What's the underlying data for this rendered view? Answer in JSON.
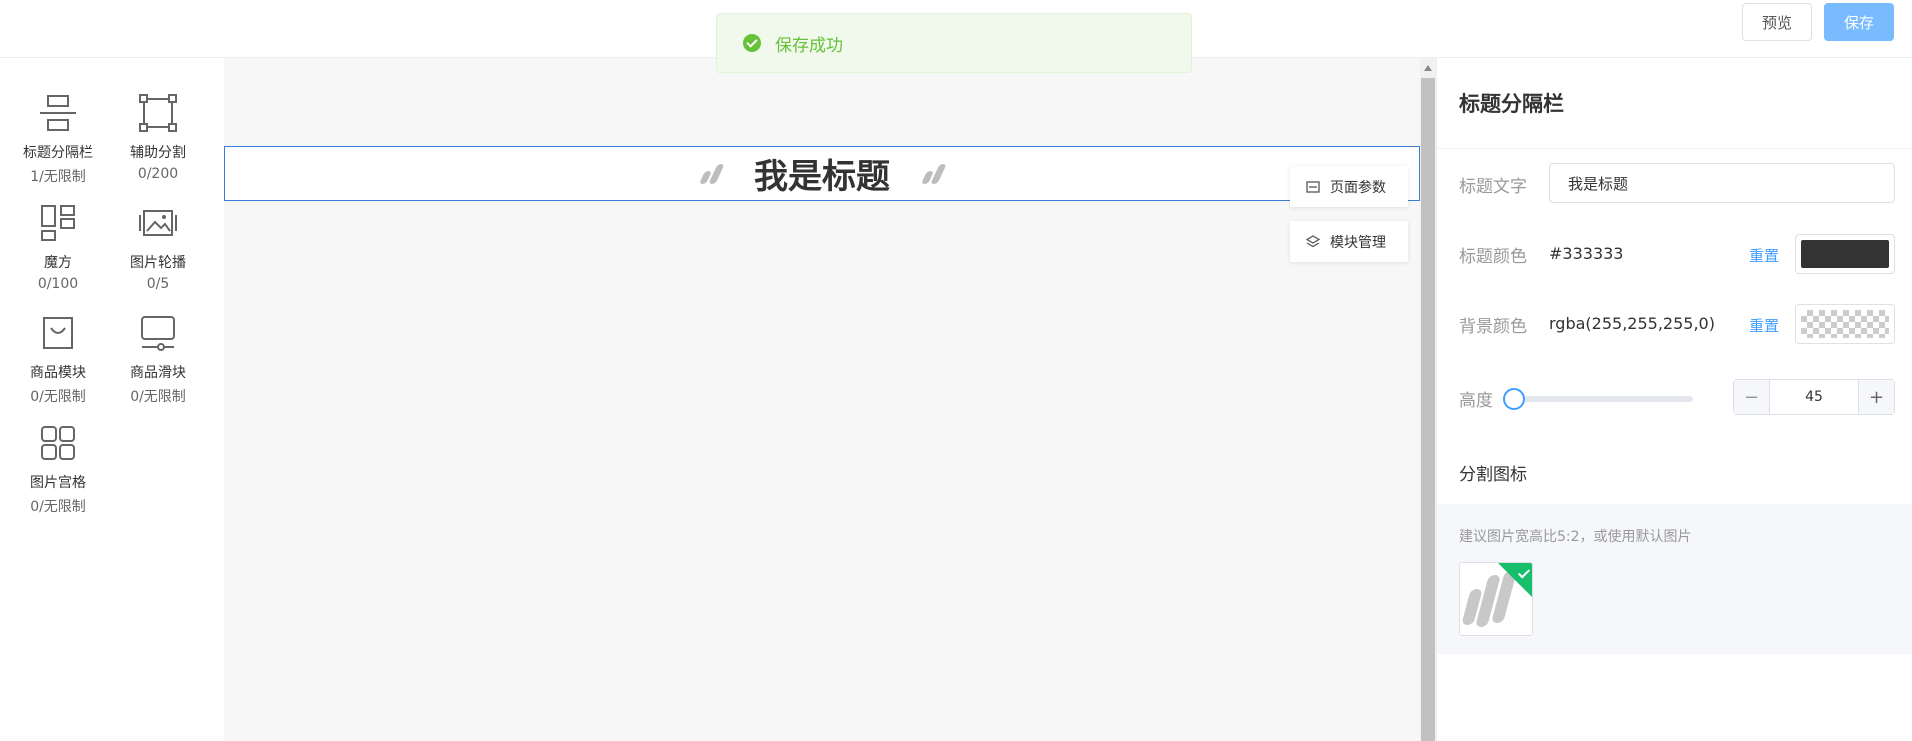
{
  "topbar": {
    "preview_label": "预览",
    "save_label": "保存"
  },
  "toast": {
    "message": "保存成功"
  },
  "components": [
    {
      "name": "标题分隔栏",
      "count": "1/无限制",
      "icon": "title-divider-icon"
    },
    {
      "name": "辅助分割",
      "count": "0/200",
      "icon": "frame-icon"
    },
    {
      "name": "魔方",
      "count": "0/100",
      "icon": "grid-layout-icon"
    },
    {
      "name": "图片轮播",
      "count": "0/5",
      "icon": "image-carousel-icon"
    },
    {
      "name": "商品模块",
      "count": "0/无限制",
      "icon": "shopping-bag-icon"
    },
    {
      "name": "商品滑块",
      "count": "0/无限制",
      "icon": "monitor-slider-icon"
    },
    {
      "name": "图片宫格",
      "count": "0/无限制",
      "icon": "four-grid-icon"
    }
  ],
  "canvas": {
    "title_text": "我是标题",
    "page_params_label": "页面参数",
    "module_manage_label": "模块管理"
  },
  "panel": {
    "title": "标题分隔栏",
    "title_text_label": "标题文字",
    "title_text_value": "我是标题",
    "title_color_label": "标题颜色",
    "title_color_value": "#333333",
    "bg_color_label": "背景颜色",
    "bg_color_value": "rgba(255,255,255,0)",
    "reset_label": "重置",
    "height_label": "高度",
    "height_value": "45",
    "divider_icon_label": "分割图标",
    "hint": "建议图片宽高比5:2，或使用默认图片",
    "colors": {
      "title": "#333333",
      "accent": "#409eff",
      "selected": "#19be6b"
    }
  }
}
